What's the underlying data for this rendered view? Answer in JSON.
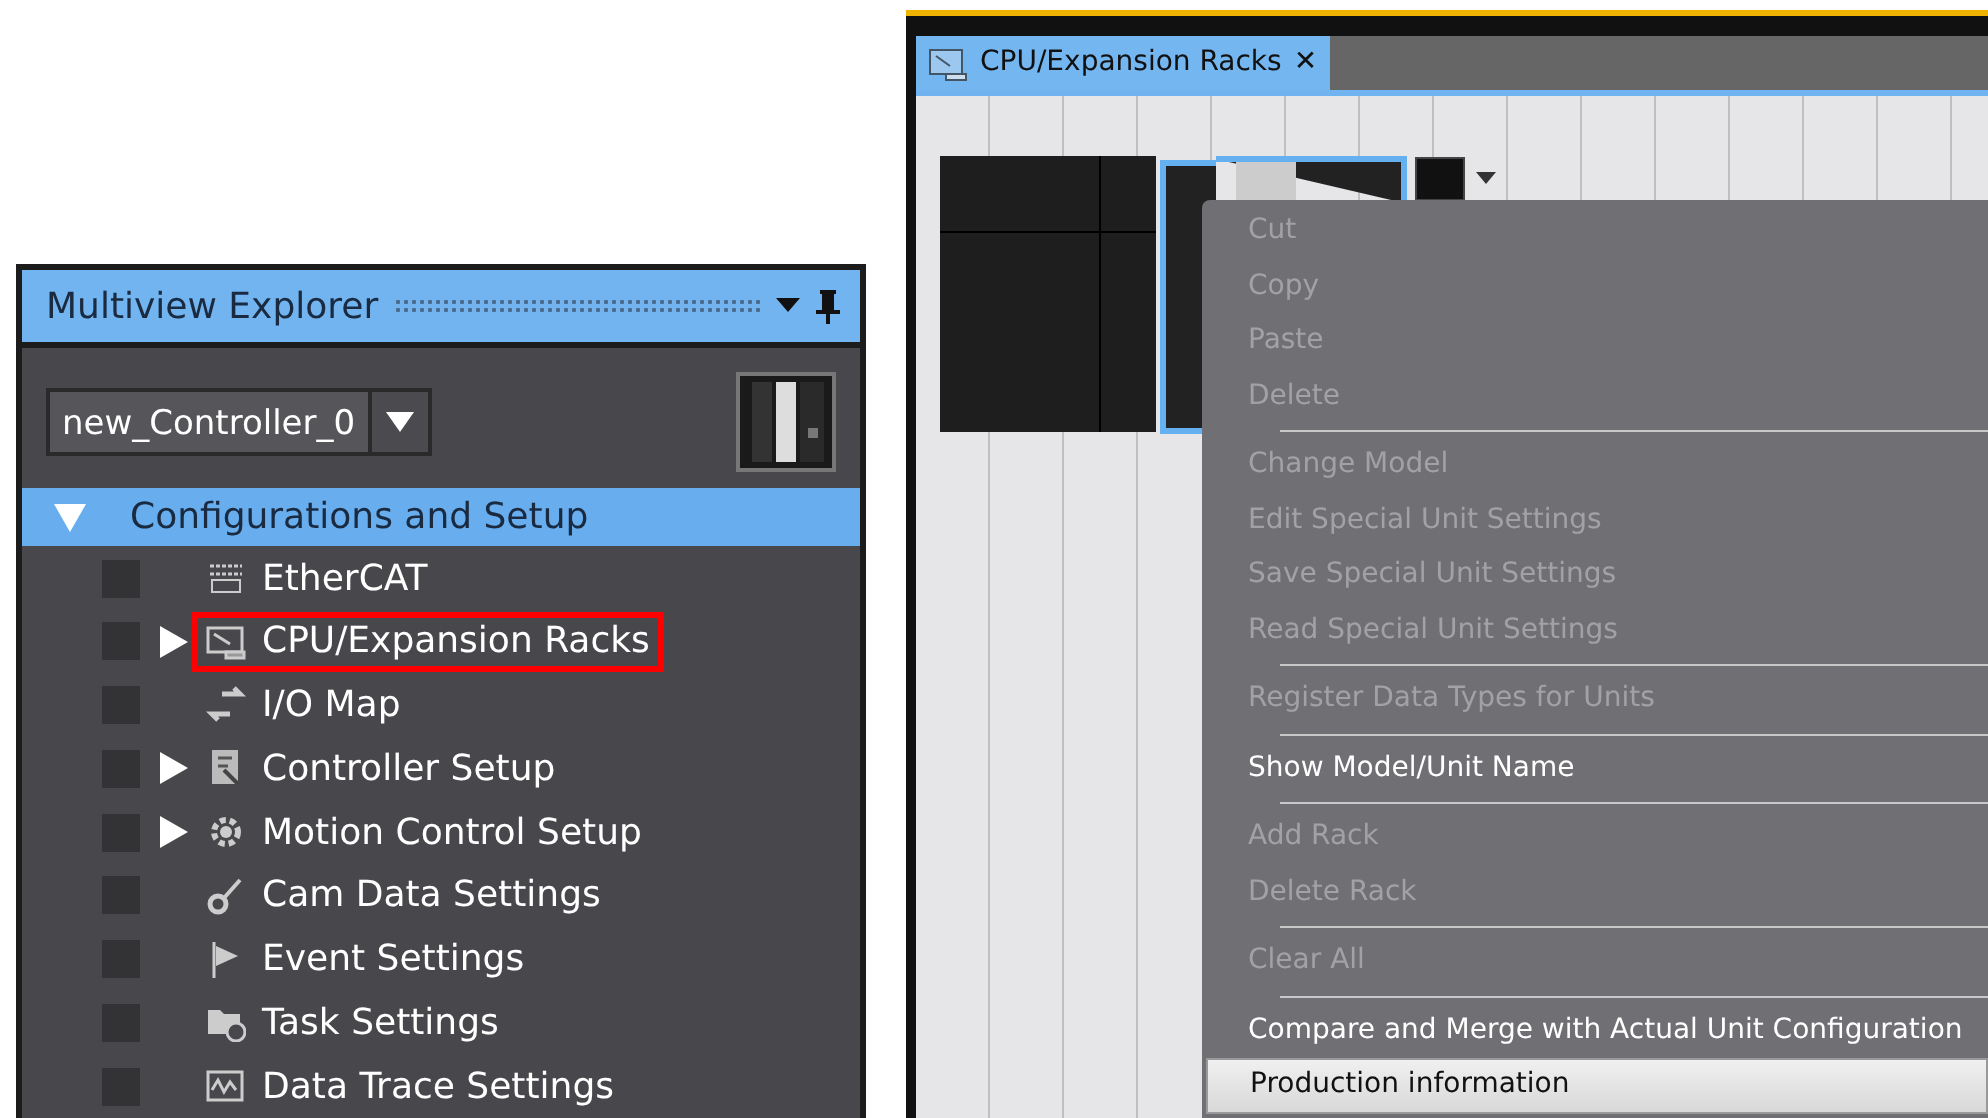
{
  "explorer": {
    "title": "Multiview Explorer",
    "controller": "new_Controller_0",
    "section": {
      "label": "Configurations and Setup",
      "expanded": true
    },
    "items": [
      {
        "label": "EtherCAT",
        "expandable": false,
        "highlighted": false
      },
      {
        "label": "CPU/Expansion Racks",
        "expandable": true,
        "highlighted": true
      },
      {
        "label": "I/O Map",
        "expandable": false,
        "highlighted": false
      },
      {
        "label": "Controller Setup",
        "expandable": true,
        "highlighted": false
      },
      {
        "label": "Motion Control Setup",
        "expandable": true,
        "highlighted": false
      },
      {
        "label": "Cam Data Settings",
        "expandable": false,
        "highlighted": false
      },
      {
        "label": "Event Settings",
        "expandable": false,
        "highlighted": false
      },
      {
        "label": "Task Settings",
        "expandable": false,
        "highlighted": false
      },
      {
        "label": "Data Trace Settings",
        "expandable": false,
        "highlighted": false
      }
    ]
  },
  "editor": {
    "tab": {
      "label": "CPU/Expansion Racks",
      "close": "✕"
    },
    "context_menu": [
      {
        "kind": "item",
        "label": "Cut",
        "disabled": true,
        "selected": false
      },
      {
        "kind": "item",
        "label": "Copy",
        "disabled": true,
        "selected": false
      },
      {
        "kind": "item",
        "label": "Paste",
        "disabled": true,
        "selected": false
      },
      {
        "kind": "item",
        "label": "Delete",
        "disabled": true,
        "selected": false
      },
      {
        "kind": "separator"
      },
      {
        "kind": "item",
        "label": "Change Model",
        "disabled": true,
        "selected": false
      },
      {
        "kind": "item",
        "label": "Edit Special Unit Settings",
        "disabled": true,
        "selected": false
      },
      {
        "kind": "item",
        "label": "Save Special Unit Settings",
        "disabled": true,
        "selected": false
      },
      {
        "kind": "item",
        "label": "Read Special Unit Settings",
        "disabled": true,
        "selected": false
      },
      {
        "kind": "separator"
      },
      {
        "kind": "item",
        "label": "Register Data Types for Units",
        "disabled": true,
        "selected": false
      },
      {
        "kind": "separator"
      },
      {
        "kind": "item",
        "label": "Show Model/Unit Name",
        "disabled": false,
        "selected": false
      },
      {
        "kind": "separator"
      },
      {
        "kind": "item",
        "label": "Add Rack",
        "disabled": true,
        "selected": false
      },
      {
        "kind": "item",
        "label": "Delete Rack",
        "disabled": true,
        "selected": false
      },
      {
        "kind": "separator"
      },
      {
        "kind": "item",
        "label": "Clear All",
        "disabled": true,
        "selected": false
      },
      {
        "kind": "separator"
      },
      {
        "kind": "item",
        "label": "Compare and Merge with Actual Unit Configuration",
        "disabled": false,
        "selected": false
      },
      {
        "kind": "item",
        "label": "Production information",
        "disabled": false,
        "selected": true
      }
    ]
  }
}
